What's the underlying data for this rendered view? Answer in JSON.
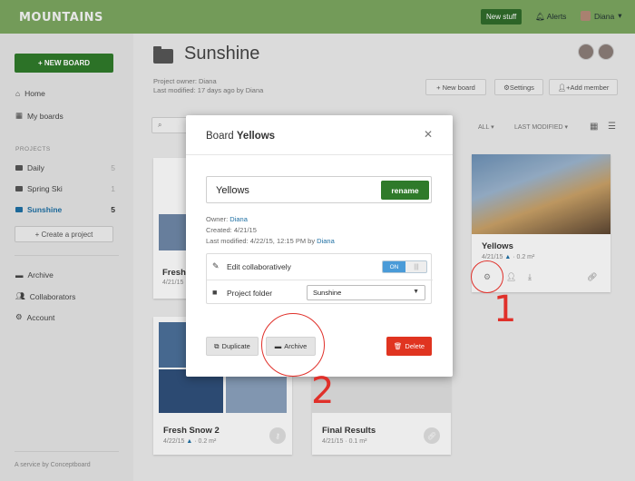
{
  "topbar": {
    "logo": "MOUNTAINS",
    "new_stuff": "New stuff",
    "alerts": "Alerts",
    "user": "Diana"
  },
  "sidebar": {
    "new_board": "+ NEW BOARD",
    "nav": [
      {
        "icon": "home-icon",
        "label": "Home"
      },
      {
        "icon": "grid-icon",
        "label": "My boards"
      }
    ],
    "projects_heading": "PROJECTS",
    "projects": [
      {
        "label": "Daily",
        "count": "5"
      },
      {
        "label": "Spring Ski",
        "count": "1"
      },
      {
        "label": "Sunshine",
        "count": "5",
        "active": true
      }
    ],
    "create_project": "+ Create a project",
    "bottom_nav": [
      {
        "icon": "archive-icon",
        "label": "Archive"
      },
      {
        "icon": "users-icon",
        "label": "Collaborators"
      },
      {
        "icon": "gear-icon",
        "label": "Account"
      }
    ],
    "footer": "A service by Conceptboard"
  },
  "main": {
    "title": "Sunshine",
    "owner": "Project owner: Diana",
    "modified": "Last modified: 17 days ago by Diana",
    "buttons": {
      "new_board": "+ New board",
      "settings": "Settings",
      "add_member": "Add member"
    },
    "filter_all": "ALL",
    "filter_sort": "LAST MODIFIED",
    "cards": [
      {
        "title": "Fresh",
        "meta": "4/21/15"
      },
      {
        "title": "Yellows",
        "meta": "4/21/15",
        "size": "0.2 m²"
      },
      {
        "title": "Fresh Snow 2",
        "meta": "4/22/15",
        "size": "0.2 m²"
      },
      {
        "title": "Final Results",
        "meta": "4/21/15",
        "size": "0.1 m²"
      }
    ]
  },
  "modal": {
    "title_prefix": "Board",
    "title_name": "Yellows",
    "name_value": "Yellows",
    "rename": "rename",
    "owner_label": "Owner:",
    "owner": "Diana",
    "created": "Created: 4/21/15",
    "modified_label": "Last modified: 4/22/15, 12:15 PM by",
    "modified_by": "Diana",
    "edit_collab": "Edit collaboratively",
    "toggle_on": "ON",
    "project_folder": "Project folder",
    "folder_value": "Sunshine",
    "duplicate": "Duplicate",
    "archive": "Archive",
    "delete": "Delete"
  },
  "annotations": {
    "one": "1",
    "two": "2"
  },
  "colors": {
    "topbar": "#7ba55f",
    "primary_green": "#2f7a2a",
    "delete_red": "#e03420",
    "link_blue": "#1e6fa3",
    "annotation": "#e0302a"
  }
}
